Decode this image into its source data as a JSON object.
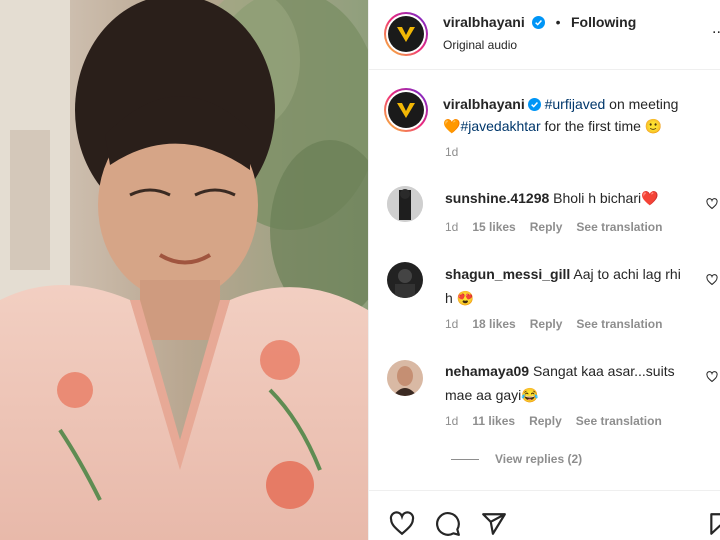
{
  "header": {
    "username": "viralbhayani",
    "separator": "•",
    "follow_status": "Following",
    "subtitle": "Original audio",
    "more": "..."
  },
  "caption": {
    "username": "viralbhayani",
    "hashtag1": "#urfijaved",
    "text1": " on meeting",
    "emoji1": "🧡",
    "hashtag2": "#javedakhtar",
    "text2": " for the first time 🙂",
    "time": "1d"
  },
  "comments": [
    {
      "username": "sunshine.41298",
      "text": "Bholi h bichari❤️",
      "time": "1d",
      "likes": "15 likes",
      "reply": "Reply",
      "translate": "See translation"
    },
    {
      "username": "shagun_messi_gill",
      "text": "Aaj to achi lag rhi",
      "text_line2": "h 😍",
      "time": "1d",
      "likes": "18 likes",
      "reply": "Reply",
      "translate": "See translation"
    },
    {
      "username": "nehamaya09",
      "text": "Sangat kaa asar...suits",
      "text_line2": "mae aa gayi😂",
      "time": "1d",
      "likes": "11 likes",
      "reply": "Reply",
      "translate": "See translation"
    }
  ],
  "view_replies": "View replies (2)",
  "colors": {
    "link": "#00376b",
    "verified": "#0095f6",
    "muted": "#8e8e8e",
    "heart": "#ed4956"
  },
  "icons": [
    "like-icon",
    "comment-icon",
    "share-icon",
    "save-icon",
    "verified-icon",
    "heart-icon"
  ]
}
